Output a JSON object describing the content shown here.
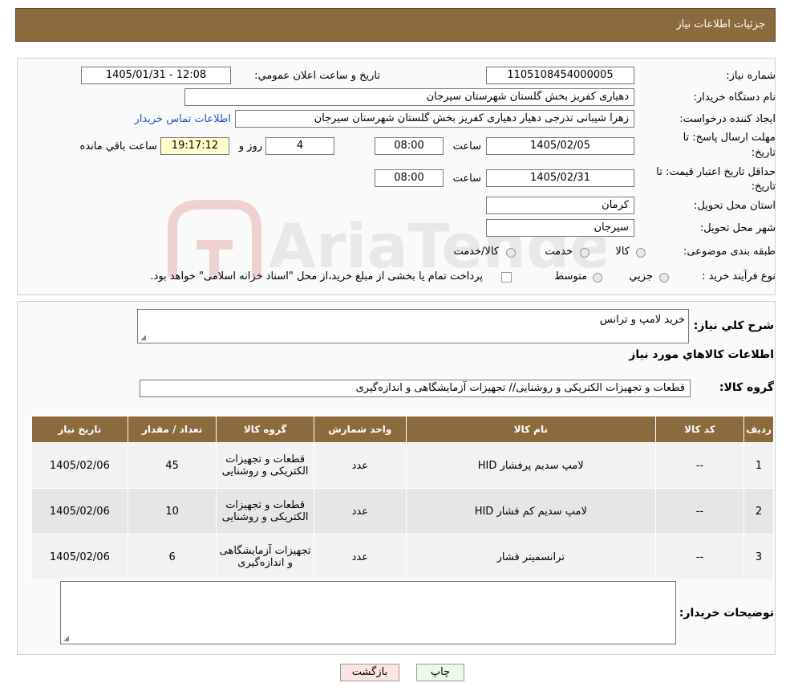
{
  "header": {
    "title": "جزئیات اطلاعات نیاز"
  },
  "form": {
    "need_number_label": "شماره نیاز:",
    "need_number": "1105108454000005",
    "announce_label": "تاریخ و ساعت اعلان عمومي:",
    "announce_value": "1405/01/31 - 12:08",
    "buyer_org_label": "نام دستگاه خريدار:",
    "buyer_org": "دهیاری کفریز بخش گلستان شهرستان سیرجان",
    "requester_label": "ايجاد كننده درخواست:",
    "requester": "زهرا شیبانی تذرجی دهیار دهیاری کفریز بخش گلستان شهرستان سیرجان",
    "contact_link": "اطلاعات تماس خريدار",
    "deadline_label_1": "مهلت ارسال پاسخ: تا",
    "deadline_label_2": "تاريخ:",
    "deadline_date": "1405/02/05",
    "time_label": "ساعت",
    "deadline_time": "08:00",
    "days_value": "4",
    "days_label": "روز و",
    "remaining_time": "19:17:12",
    "remaining_label": "ساعت باقي مانده",
    "validity_label_1": "حداقل تاريخ اعتبار قيمت: تا",
    "validity_label_2": "تاريخ:",
    "validity_date": "1405/02/31",
    "validity_time": "08:00",
    "province_label": "استان محل تحويل:",
    "province": "کرمان",
    "city_label": "شهر محل تحويل:",
    "city": "سیرجان",
    "category_label": "طبقه بندی موضوعی:",
    "category_options": [
      "كالا",
      "خدمت",
      "كالا/خدمت"
    ],
    "process_label": "نوع فرآيند خريد :",
    "process_options": [
      "جزيي",
      "متوسط"
    ],
    "payment_note": "پرداخت تمام يا بخشی از مبلغ خريد،از محل \"اسناد خزانه اسلامی\" خواهد بود."
  },
  "summary": {
    "description_label": "شرح كلي نياز:",
    "description": "خرید لامپ و ترانس",
    "items_heading": "اطلاعات كالاهاي مورد نياز",
    "group_label": "گروه كالا:",
    "group_value": "قطعات و تجهیزات الکتریکی و روشنایی// تجهیزات آزمایشگاهی و اندازه‌گیری"
  },
  "table": {
    "headers": [
      "رديف",
      "كد كالا",
      "نام كالا",
      "واحد شمارش",
      "گروه كالا",
      "تعداد / مقدار",
      "تاريخ نياز"
    ],
    "rows": [
      [
        "1",
        "--",
        "لامپ سدیم پرفشار HID",
        "عدد",
        "قطعات و تجهیزات الکتریکی و روشنایی",
        "45",
        "1405/02/06"
      ],
      [
        "2",
        "--",
        "لامپ سدیم کم فشار HID",
        "عدد",
        "قطعات و تجهیزات الکتریکی و روشنایی",
        "10",
        "1405/02/06"
      ],
      [
        "3",
        "--",
        "ترانسمیتر فشار",
        "عدد",
        "تجهیزات آزمایشگاهی و اندازه‌گیری",
        "6",
        "1405/02/06"
      ]
    ]
  },
  "buyer_notes": {
    "label": "توضيحات خريدار:",
    "value": ""
  },
  "buttons": {
    "print": "چاپ",
    "back": "بازگشت"
  },
  "watermark": {
    "text": "AriaTender.neT"
  }
}
